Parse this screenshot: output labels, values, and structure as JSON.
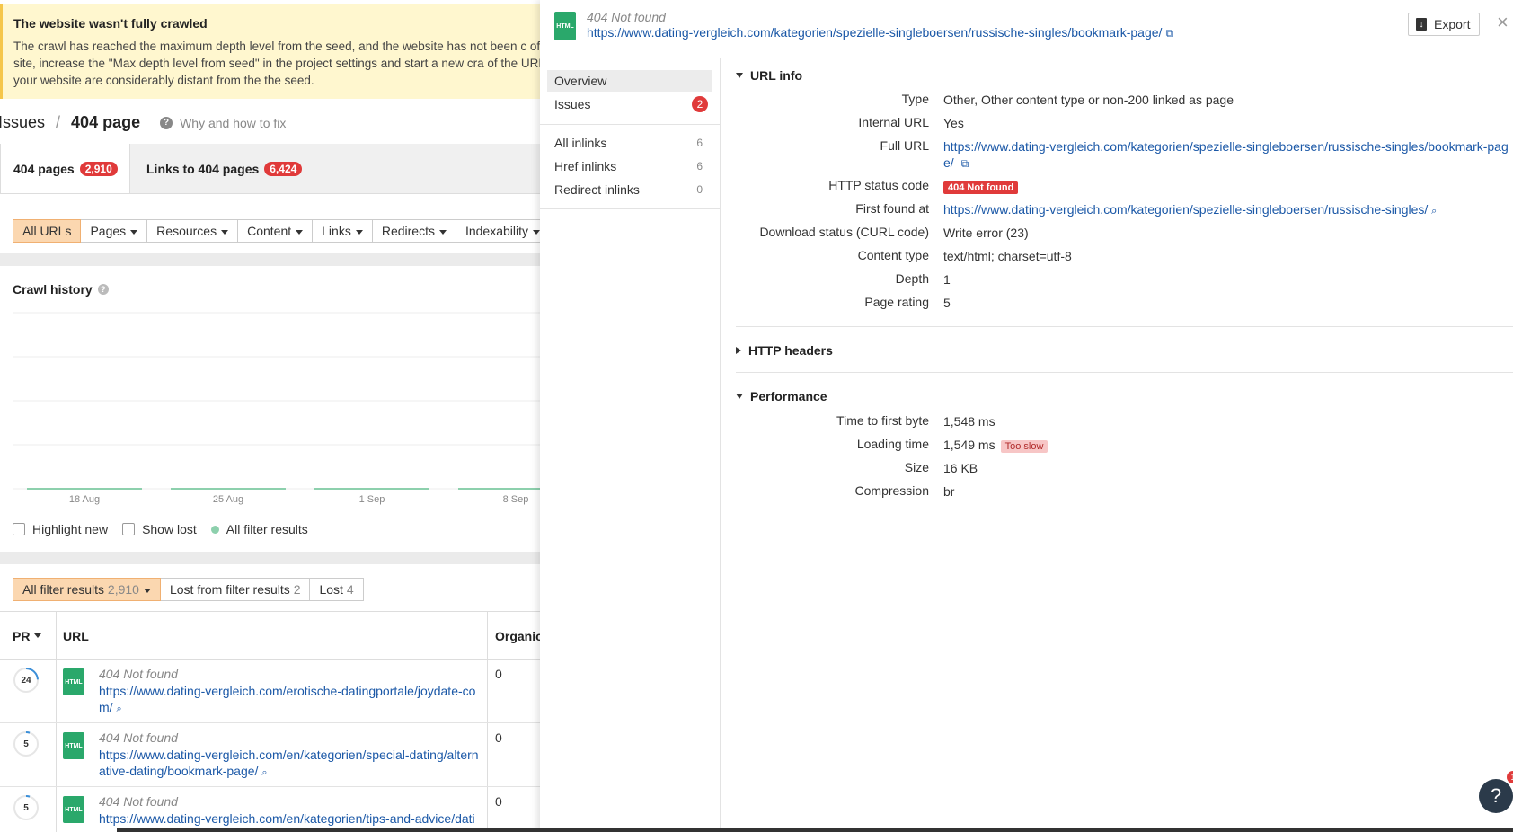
{
  "warning": {
    "title": "The website wasn't fully crawled",
    "text": "The crawl has reached the maximum depth level from the seed, and the website has not been c of your site, increase the \"Max depth level from seed\" in the project settings and start a new cra of the URLs on your website are considerably distant from the the seed."
  },
  "breadcrumb": {
    "parent": "Issues",
    "current": "404 page",
    "help": "Why and how to fix"
  },
  "tabs": [
    {
      "label": "404 pages",
      "count": "2,910"
    },
    {
      "label": "Links to 404 pages",
      "count": "6,424"
    }
  ],
  "filters": [
    "All URLs",
    "Pages",
    "Resources",
    "Content",
    "Links",
    "Redirects",
    "Indexability"
  ],
  "crawl_history": {
    "title": "Crawl history",
    "x_ticks": [
      "18 Aug",
      "25 Aug",
      "1 Sep",
      "8 Sep"
    ],
    "legend": {
      "highlight_new": "Highlight new",
      "show_lost": "Show lost",
      "all_results": "All filter results"
    }
  },
  "result_tabs": [
    {
      "label": "All filter results",
      "count": "2,910"
    },
    {
      "label": "Lost from filter results",
      "count": "2"
    },
    {
      "label": "Lost",
      "count": "4"
    }
  ],
  "table": {
    "headers": {
      "pr": "PR",
      "url": "URL",
      "organic": "Organic"
    },
    "rows": [
      {
        "pr": "24",
        "pr_frac": 0.24,
        "status": "404 Not found",
        "url": "https://www.dating-vergleich.com/erotische-datingportale/joydate-com/",
        "organic": "0"
      },
      {
        "pr": "5",
        "pr_frac": 0.05,
        "status": "404 Not found",
        "url": "https://www.dating-vergleich.com/en/kategorien/special-dating/alternative-dating/bookmark-page/",
        "organic": "0"
      },
      {
        "pr": "5",
        "pr_frac": 0.05,
        "status": "404 Not found",
        "url": "https://www.dating-vergleich.com/en/kategorien/tips-and-advice/dati",
        "organic": "0"
      }
    ]
  },
  "panel": {
    "status": "404 Not found",
    "url": "https://www.dating-vergleich.com/kategorien/spezielle-singleboersen/russische-singles/bookmark-page/",
    "export_label": "Export",
    "nav": [
      {
        "label": "Overview"
      },
      {
        "label": "Issues",
        "badge": "2"
      },
      {
        "label": "All inlinks",
        "count": "6"
      },
      {
        "label": "Href inlinks",
        "count": "6"
      },
      {
        "label": "Redirect inlinks",
        "count": "0"
      }
    ],
    "url_info": {
      "title": "URL info",
      "type_k": "Type",
      "type_v": "Other, Other content type or non-200 linked as page",
      "internal_k": "Internal URL",
      "internal_v": "Yes",
      "full_k": "Full URL",
      "full_v": "https://www.dating-vergleich.com/kategorien/spezielle-singleboersen/russische-singles/bookmark-page/",
      "http_k": "HTTP status code",
      "http_v": "404 Not found",
      "first_k": "First found at",
      "first_v": "https://www.dating-vergleich.com/kategorien/spezielle-singleboersen/russische-singles/",
      "curl_k": "Download status (CURL code)",
      "curl_v": "Write error (23)",
      "ctype_k": "Content type",
      "ctype_v": "text/html; charset=utf-8",
      "depth_k": "Depth",
      "depth_v": "1",
      "rating_k": "Page rating",
      "rating_v": "5"
    },
    "http_headers_title": "HTTP headers",
    "performance": {
      "title": "Performance",
      "ttfb_k": "Time to first byte",
      "ttfb_v": "1,548 ms",
      "load_k": "Loading time",
      "load_v": "1,549 ms",
      "load_tag": "Too slow",
      "size_k": "Size",
      "size_v": "16 KB",
      "comp_k": "Compression",
      "comp_v": "br"
    },
    "help_badge": "1"
  },
  "icons": {
    "file": "HTML",
    "help": "?",
    "close": "×",
    "external": "⧉",
    "search": "🔍"
  }
}
